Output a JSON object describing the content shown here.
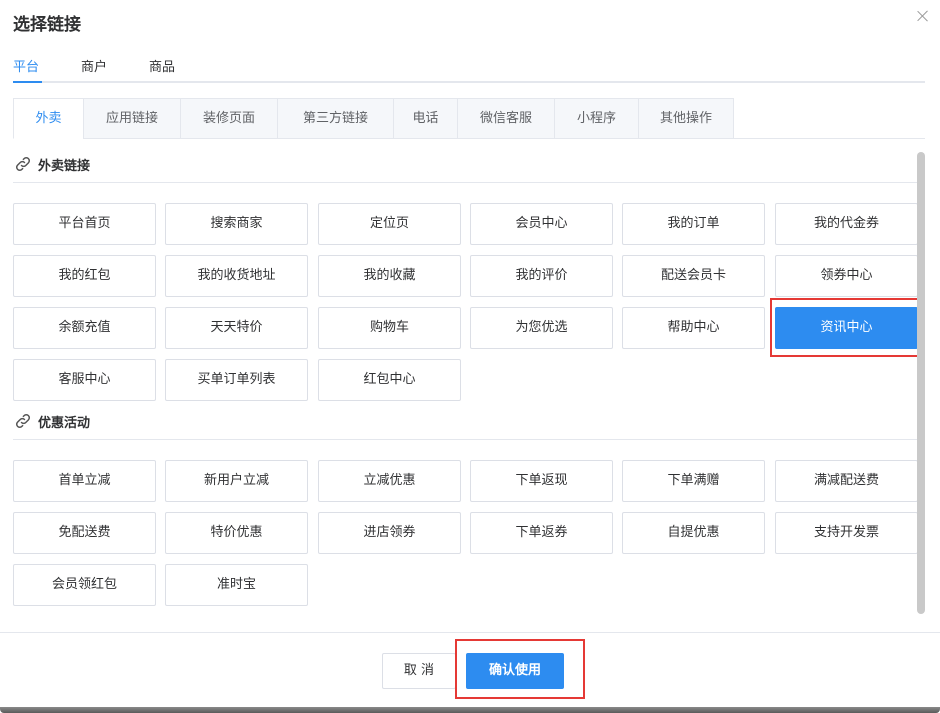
{
  "dialog": {
    "title": "选择链接"
  },
  "top_tabs": [
    "平台",
    "商户",
    "商品"
  ],
  "category_tabs": [
    "外卖",
    "应用链接",
    "装修页面",
    "第三方链接",
    "电话",
    "微信客服",
    "小程序",
    "其他操作"
  ],
  "sections": {
    "takeout": {
      "label": "外卖链接",
      "items": [
        "平台首页",
        "搜索商家",
        "定位页",
        "会员中心",
        "我的订单",
        "我的代金券",
        "我的红包",
        "我的收货地址",
        "我的收藏",
        "我的评价",
        "配送会员卡",
        "领券中心",
        "余额充值",
        "天天特价",
        "购物车",
        "为您优选",
        "帮助中心",
        "资讯中心",
        "客服中心",
        "买单订单列表",
        "红包中心"
      ],
      "selected": "资讯中心"
    },
    "promotions": {
      "label": "优惠活动",
      "items": [
        "首单立减",
        "新用户立减",
        "立减优惠",
        "下单返现",
        "下单满赠",
        "满减配送费",
        "免配送费",
        "特价优惠",
        "进店领券",
        "下单返券",
        "自提优惠",
        "支持开发票",
        "会员领红包",
        "准时宝"
      ]
    }
  },
  "footer": {
    "cancel_label": "取 消",
    "confirm_label": "确认使用"
  },
  "colors": {
    "accent": "#2d8cf0",
    "highlight": "#e53935"
  },
  "icons": {
    "close": "close-icon",
    "link": "link-icon"
  }
}
